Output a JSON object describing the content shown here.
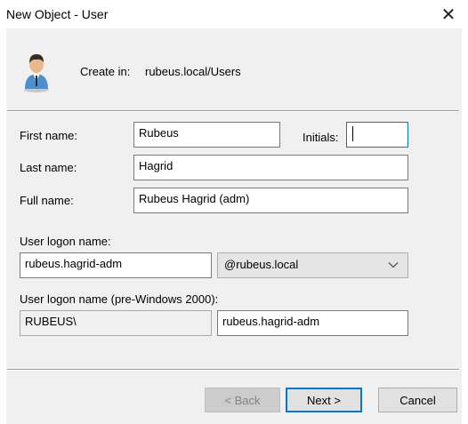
{
  "window": {
    "title": "New Object - User",
    "close_glyph": "✕"
  },
  "header": {
    "create_in_label": "Create in:",
    "create_in_path": "rubeus.local/Users",
    "icon": "user-icon"
  },
  "form": {
    "first_name": {
      "label": "First name:",
      "value": "Rubeus"
    },
    "initials": {
      "label": "Initials:",
      "value": ""
    },
    "last_name": {
      "label": "Last name:",
      "value": "Hagrid"
    },
    "full_name": {
      "label": "Full name:",
      "value": "Rubeus Hagrid (adm)"
    },
    "logon": {
      "label": "User logon name:",
      "value": "rubeus.hagrid-adm",
      "domain": "@rubeus.local"
    },
    "pre2000": {
      "label": "User logon name (pre-Windows 2000):",
      "prefix": "RUBEUS\\",
      "value": "rubeus.hagrid-adm"
    }
  },
  "buttons": {
    "back": "< Back",
    "next": "Next >",
    "cancel": "Cancel"
  },
  "colors": {
    "accent": "#0078d7",
    "dialog_bg": "#f0f0f0",
    "icon_shirt": "#4a8fd0"
  }
}
